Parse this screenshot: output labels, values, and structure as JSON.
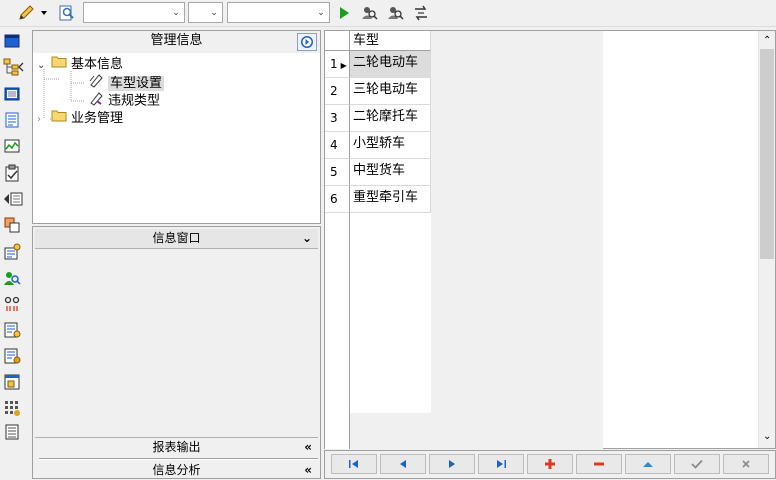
{
  "toolbar": {
    "combo1_value": "",
    "combo2_value": "",
    "combo3_value": ""
  },
  "management": {
    "title": "管理信息",
    "tree": [
      {
        "label": "基本信息",
        "expanded": true
      },
      {
        "label": "车型设置",
        "selected": true
      },
      {
        "label": "违规类型"
      },
      {
        "label": "业务管理",
        "expanded": false
      }
    ]
  },
  "panes": {
    "info_window": "信息窗口",
    "report_output": "报表输出",
    "info_analysis": "信息分析"
  },
  "grid": {
    "column_header": "车型",
    "rows": [
      {
        "num": "1",
        "value": "二轮电动车",
        "current": true
      },
      {
        "num": "2",
        "value": "三轮电动车"
      },
      {
        "num": "3",
        "value": "二轮摩托车"
      },
      {
        "num": "4",
        "value": "小型轿车"
      },
      {
        "num": "5",
        "value": "中型货车"
      },
      {
        "num": "6",
        "value": "重型牵引车"
      }
    ]
  },
  "navigator": {
    "buttons": [
      "first-icon",
      "prior-icon",
      "next-icon",
      "last-icon",
      "insert-icon",
      "delete-icon",
      "edit-icon",
      "post-icon",
      "cancel-icon"
    ]
  },
  "colors": {
    "accent_blue": "#1e5fd1",
    "play_green": "#18a018",
    "insert_red": "#e03a1e",
    "selection_gray": "#dcdcdc"
  }
}
